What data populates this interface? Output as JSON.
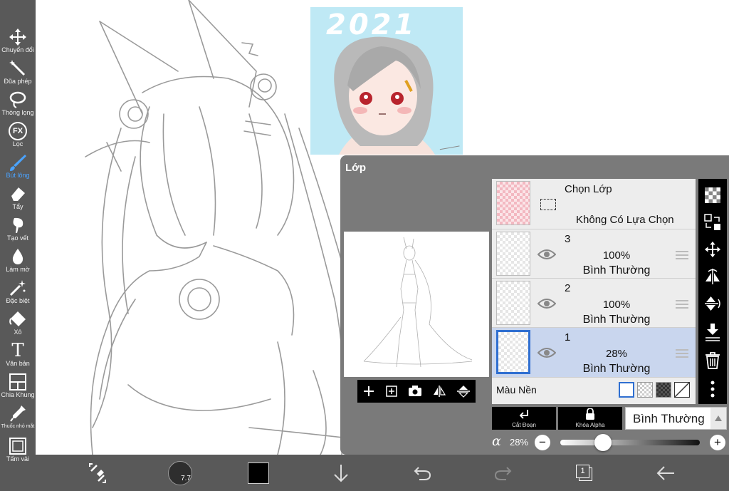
{
  "toolbar": {
    "tools": [
      {
        "label": "Chuyển đổi",
        "icon": "move-icon"
      },
      {
        "label": "Đũa phép",
        "icon": "magic-wand-icon"
      },
      {
        "label": "Thòng lọng",
        "icon": "lasso-icon"
      },
      {
        "label": "Lọc",
        "icon": "fx-filter-icon",
        "icon_text": "FX"
      },
      {
        "label": "Bút lông",
        "icon": "brush-icon",
        "active": true
      },
      {
        "label": "Tẩy",
        "icon": "eraser-icon"
      },
      {
        "label": "Tạo vết",
        "icon": "smudge-icon"
      },
      {
        "label": "Làm mờ",
        "icon": "blur-drop-icon"
      },
      {
        "label": "Đặc biệt",
        "icon": "special-sparkle-icon"
      },
      {
        "label": "Xô",
        "icon": "bucket-icon"
      },
      {
        "label": "Văn bản",
        "icon": "text-icon",
        "icon_text": "T"
      },
      {
        "label": "Chia Khung",
        "icon": "frame-divider-icon"
      },
      {
        "label": "Thuốc nhỏ mắt",
        "icon": "eyedropper-icon"
      },
      {
        "label": "Tấm vải",
        "icon": "canvas-icon"
      }
    ],
    "active_color": "#4aa3ff"
  },
  "reference_art": {
    "year_text": "2021"
  },
  "bottom_bar": {
    "brush_size": "7.7",
    "current_color": "#000000",
    "layer_count": "1"
  },
  "layer_panel": {
    "title": "Lớp",
    "selection_layer": {
      "title": "Chọn Lớp",
      "status": "Không Có Lựa Chọn"
    },
    "layers": [
      {
        "number": "3",
        "opacity": "100%",
        "mode": "Bình Thường",
        "selected": false
      },
      {
        "number": "2",
        "opacity": "100%",
        "mode": "Bình Thường",
        "selected": false
      },
      {
        "number": "1",
        "opacity": "28%",
        "mode": "Bình Thường",
        "selected": true
      }
    ],
    "background_label": "Màu Nền",
    "clipping_label": "Cắt Đoạn",
    "alpha_lock_label": "Khóa Alpha",
    "blend_mode": "Bình Thường",
    "alpha_symbol": "α",
    "alpha_value": "28%",
    "alpha_fraction": 0.28,
    "selected_color": "#c9d6ee",
    "accent_color": "#2f6fd1"
  }
}
